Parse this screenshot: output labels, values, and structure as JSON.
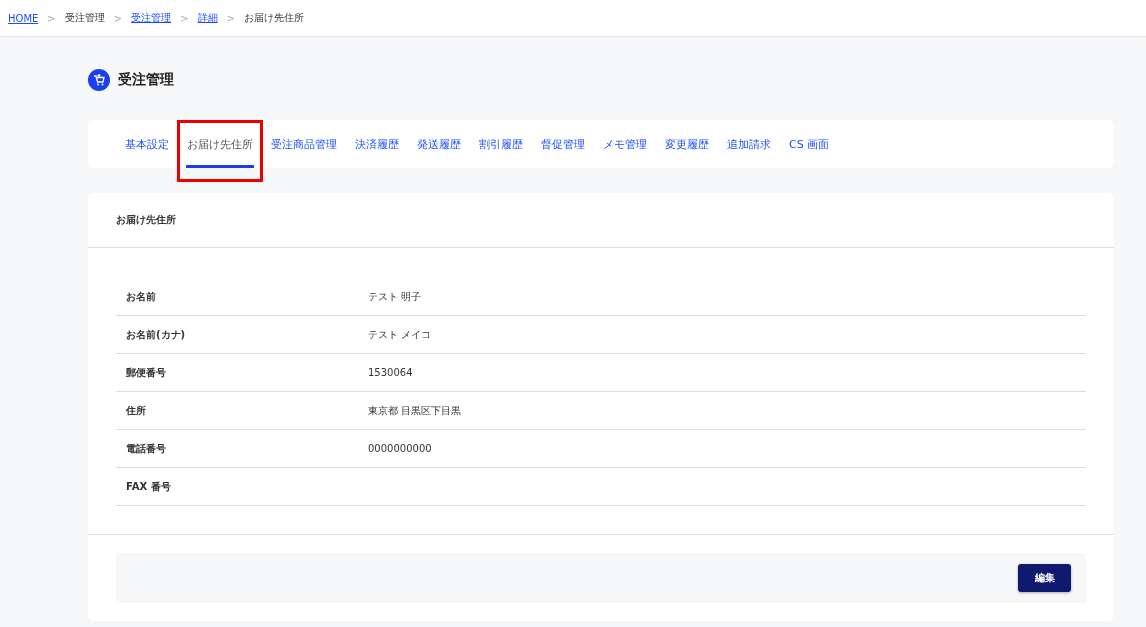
{
  "breadcrumb": [
    {
      "text": "HOME",
      "link": true
    },
    {
      "separator": ">",
      "text": "受注管理",
      "link": false
    },
    {
      "separator": ">",
      "text": "受注管理",
      "link": true
    },
    {
      "separator": ">",
      "text": "詳細",
      "link": true
    },
    {
      "separator": ">",
      "text": "お届け先住所",
      "link": false
    }
  ],
  "page_title": "受注管理",
  "tabs": [
    {
      "label": "基本設定",
      "selected": false,
      "highlighted": false
    },
    {
      "label": "お届け先住所",
      "selected": true,
      "highlighted": true
    },
    {
      "label": "受注商品管理",
      "selected": false,
      "highlighted": false
    },
    {
      "label": "決済履歴",
      "selected": false,
      "highlighted": false
    },
    {
      "label": "発送履歴",
      "selected": false,
      "highlighted": false
    },
    {
      "label": "割引履歴",
      "selected": false,
      "highlighted": false
    },
    {
      "label": "督促管理",
      "selected": false,
      "highlighted": false
    },
    {
      "label": "メモ管理",
      "selected": false,
      "highlighted": false
    },
    {
      "label": "変更履歴",
      "selected": false,
      "highlighted": false
    },
    {
      "label": "追加請求",
      "selected": false,
      "highlighted": false
    },
    {
      "label": "CS 画面",
      "selected": false,
      "highlighted": false
    }
  ],
  "card": {
    "title": "お届け先住所",
    "rows": [
      {
        "label": "お名前",
        "value": "テスト 明子"
      },
      {
        "label": "お名前(カナ)",
        "value": "テスト メイコ"
      },
      {
        "label": "郵便番号",
        "value": "1530064"
      },
      {
        "label": "住所",
        "value": "東京都 目黒区下目黒"
      },
      {
        "label": "電話番号",
        "value": "0000000000"
      },
      {
        "label": "FAX 番号"
      }
    ],
    "button": "編集"
  }
}
